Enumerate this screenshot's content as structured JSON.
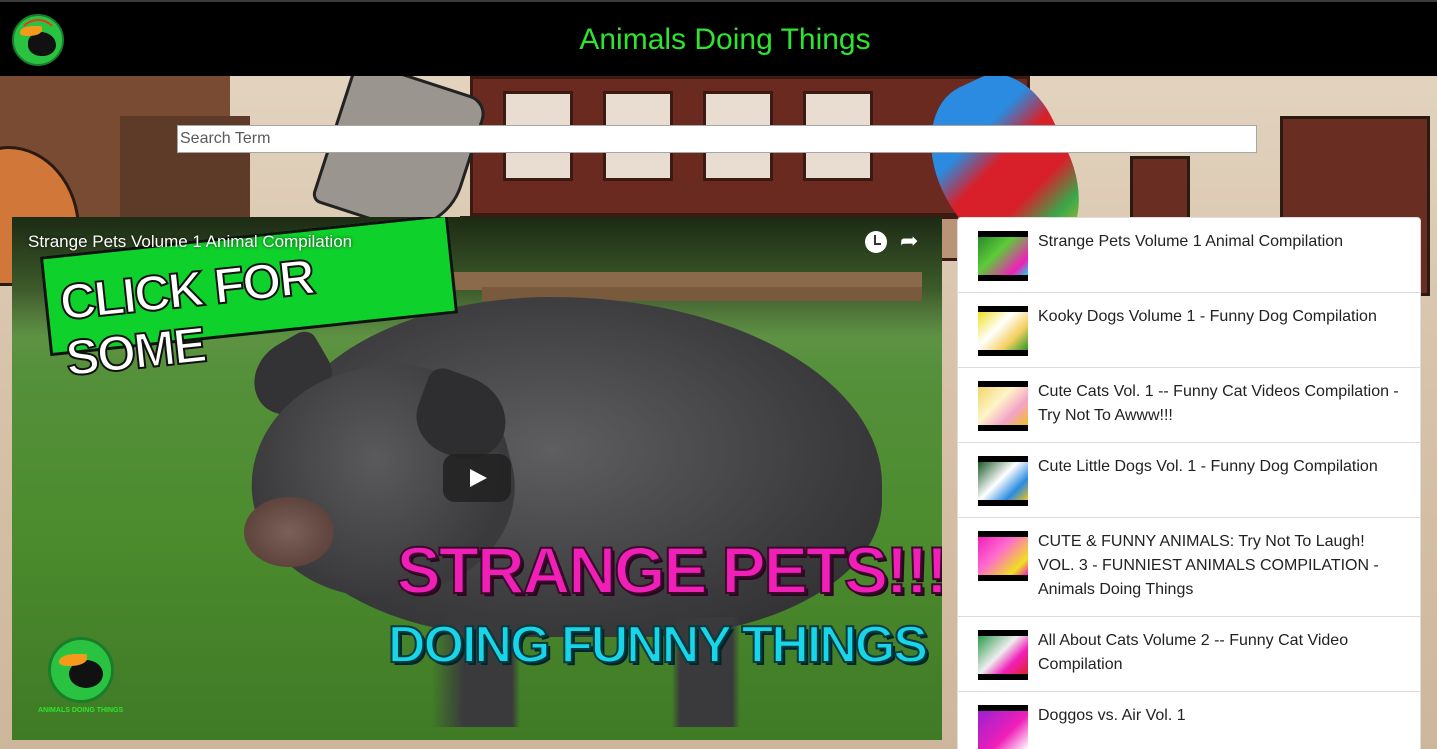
{
  "header": {
    "title": "Animals Doing Things",
    "logo_icon": "toucan-logo-icon"
  },
  "search": {
    "placeholder": "Search Term",
    "value": ""
  },
  "player": {
    "title": "Strange Pets Volume 1 Animal Compilation",
    "thumbnail_banner": "CLICK FOR SOME",
    "thumbnail_headline": "STRANGE PETS!!!",
    "thumbnail_subhead": "DOING FUNNY THINGS",
    "watermark_text": "ANIMALS DOING THINGS",
    "icons": [
      "watch-later-icon",
      "share-icon",
      "play-icon"
    ]
  },
  "playlist": {
    "items": [
      {
        "title": "Strange Pets Volume 1 Animal Compilation"
      },
      {
        "title": "Kooky Dogs Volume 1 - Funny Dog Compilation"
      },
      {
        "title": "Cute Cats Vol. 1 -- Funny Cat Videos Compilation - Try Not To Awww!!!"
      },
      {
        "title": "Cute Little Dogs Vol. 1 - Funny Dog Compilation"
      },
      {
        "title": "CUTE & FUNNY ANIMALS: Try Not To Laugh! VOL. 3 - FUNNIEST ANIMALS COMPILATION - Animals Doing Things"
      },
      {
        "title": "All About Cats Volume 2 -- Funny Cat Video Compilation"
      },
      {
        "title": "Doggos vs. Air Vol. 1"
      }
    ]
  },
  "colors": {
    "header_bg": "#000000",
    "title_green": "#2de52d",
    "headline_pink": "#f01fb8",
    "subhead_cyan": "#18d6e8"
  }
}
